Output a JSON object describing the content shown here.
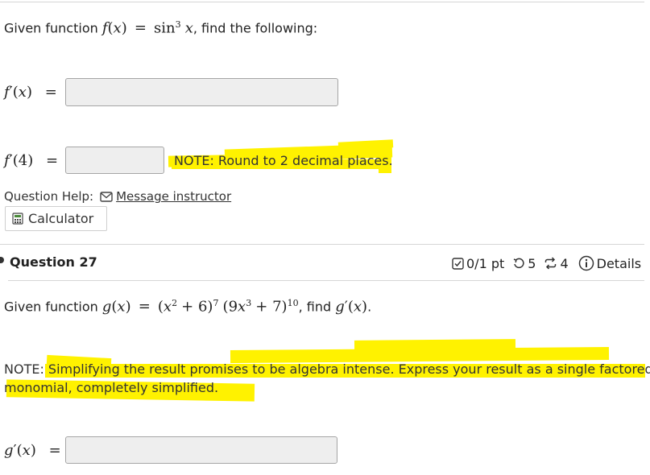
{
  "q26": {
    "prompt_prefix": "Given function",
    "fn_name": "f",
    "fn_arg": "x",
    "equals": "=",
    "fn_def_func": "sin",
    "fn_def_power": "3",
    "fn_def_var": "x",
    "prompt_suffix": ", find the following:",
    "part1_label_fn": "f",
    "part1_label_prime": "′",
    "part1_label_arg": "x",
    "part2_label_fn": "f",
    "part2_label_prime": "′",
    "part2_label_arg": "4",
    "note": "NOTE: Round to 2 decimal places.",
    "help_label": "Question Help:",
    "message_link": "Message instructor",
    "calculator_label": "Calculator"
  },
  "q27": {
    "title": "Question 27",
    "score": "0/1 pt",
    "retries": "5",
    "attempts": "4",
    "details_label": "Details",
    "prompt_prefix": "Given function",
    "fn_name": "g",
    "fn_arg": "x",
    "equals": "=",
    "term1_base": "x",
    "term1_base_exp": "2",
    "term1_const": "+ 6",
    "term1_exp": "7",
    "term2_coef": "9",
    "term2_var": "x",
    "term2_var_exp": "3",
    "term2_const": "+ 7",
    "term2_exp": "10",
    "find_text": ", find",
    "find_fn": "g",
    "find_prime": "′",
    "find_arg": "x",
    "period": ".",
    "note_line1": "NOTE: Simplifying the result promises to be algebra intense. Express your result as a single factored",
    "note_line2": "monomial, completely simplified.",
    "answer_label_fn": "g",
    "answer_label_prime": "′",
    "answer_label_arg": "x"
  },
  "icons": {
    "message": "envelope-icon",
    "calculator": "calculator-icon",
    "score": "checkbox-icon",
    "retries": "retry-icon",
    "attempts": "refresh-arrows-icon",
    "details": "info-icon"
  },
  "colors": {
    "highlight": "#fff200",
    "input_bg": "#eeeeee",
    "divider": "#d6d6d6"
  }
}
